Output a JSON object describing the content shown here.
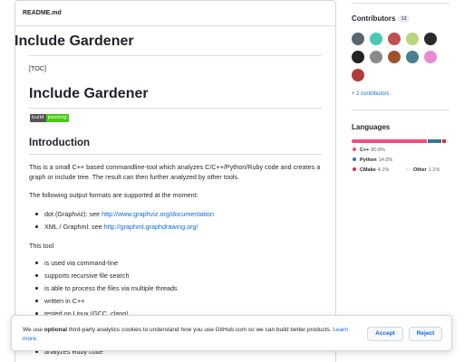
{
  "readme": {
    "filename": "README.md",
    "title1": "Include Gardener",
    "toc": "[TOC]",
    "title2": "Include Gardener",
    "badge_left": "build",
    "badge_right": "passing",
    "intro_heading": "Introduction",
    "intro_para": "This is a small C++ based commandline-tool which analyzes C/C++/Python/Ruby code and creates a graph or include tree. The result can then further analyzed by other tools.",
    "formats_para": "The following output formats are supported at the moment:",
    "formats": [
      {
        "prefix": "dot (Graphviz): see ",
        "link": "http://www.graphviz.org/documentation"
      },
      {
        "prefix": "XML / Graphml: see ",
        "link": "http://graphml.graphdrawing.org/"
      }
    ],
    "tool_para": "This tool",
    "tool_items": [
      "is used via command-line",
      "supports recursive file search",
      "is able to process the files via multiple threads",
      "written in C++",
      "tested on Linux (GCC, clang)",
      "analyzes Ruby code"
    ]
  },
  "sidebar": {
    "contributors_title": "Contributors",
    "contributors_count": "13",
    "more_contributors": "+ 2 contributors",
    "avatars": [
      {
        "name": "avatar-1",
        "color": "#5b6770"
      },
      {
        "name": "avatar-2",
        "color": "#48c9b0"
      },
      {
        "name": "avatar-3",
        "color": "#c0504d"
      },
      {
        "name": "avatar-4",
        "color": "#b7d77a"
      },
      {
        "name": "avatar-5",
        "color": "#2a2a2a"
      },
      {
        "name": "avatar-6",
        "color": "#222222"
      },
      {
        "name": "avatar-7",
        "color": "#8a8a8a"
      },
      {
        "name": "avatar-8",
        "color": "#a0522d"
      },
      {
        "name": "avatar-9",
        "color": "#4a7f8f"
      },
      {
        "name": "avatar-10",
        "color": "#e88bd0"
      },
      {
        "name": "avatar-11",
        "color": "#b23a3a"
      }
    ],
    "languages_title": "Languages",
    "languages": [
      {
        "name": "C++",
        "percent": "80.8%",
        "value": 80.8,
        "color": "#f34b7d"
      },
      {
        "name": "Python",
        "percent": "14.0%",
        "value": 14.0,
        "color": "#3572A5"
      },
      {
        "name": "CMake",
        "percent": "4.1%",
        "value": 4.1,
        "color": "#DA3434"
      },
      {
        "name": "Other",
        "percent": "1.1%",
        "value": 1.1,
        "color": "#ededed"
      }
    ]
  },
  "cookie": {
    "text_before": "We use ",
    "text_bold": "optional",
    "text_after": " third-party analytics cookies to understand how you use GitHub.com so we can build better products. ",
    "learn_more": "Learn more.",
    "accept": "Accept",
    "reject": "Reject"
  }
}
